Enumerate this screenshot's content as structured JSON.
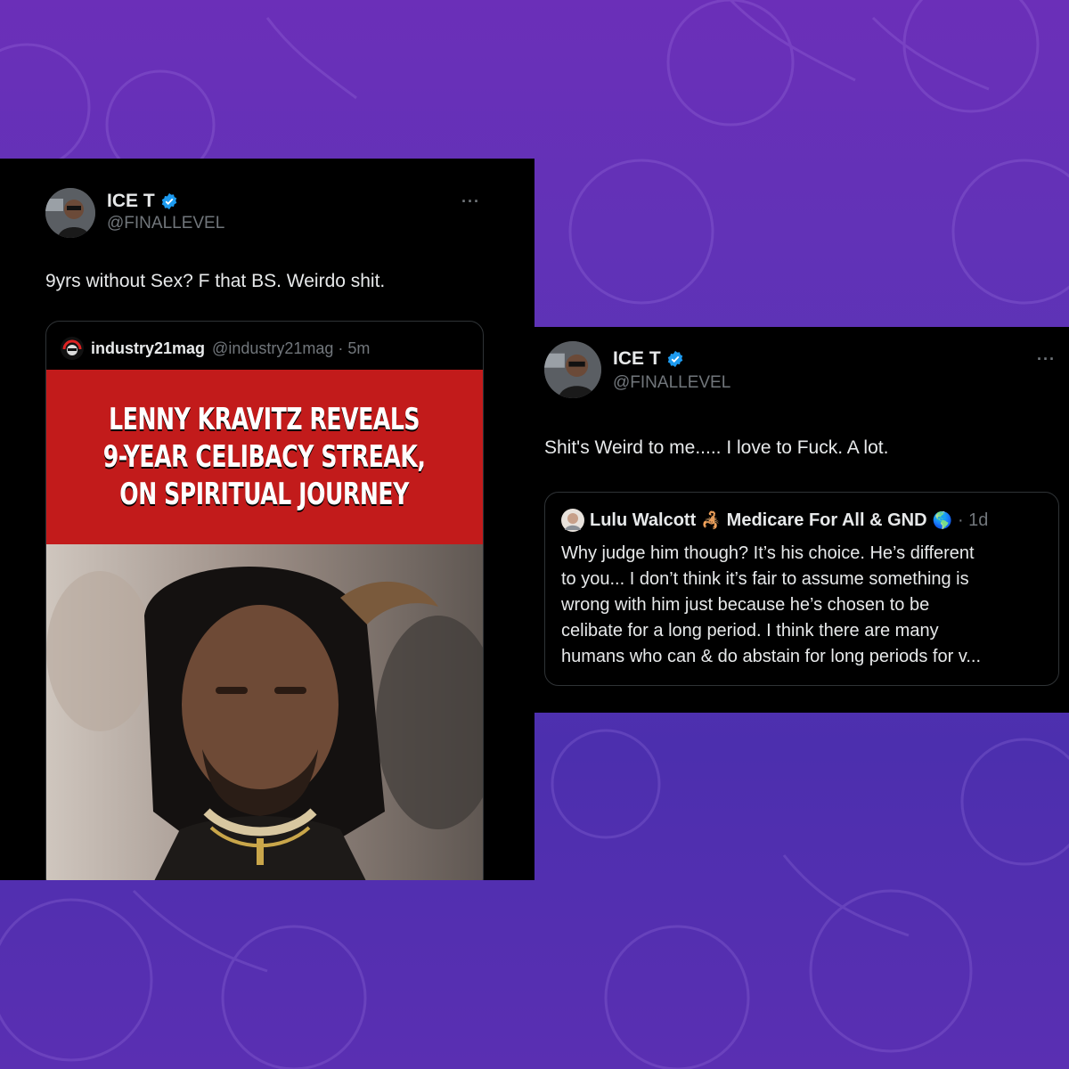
{
  "colors": {
    "background_top": "#6b2fb8",
    "background_bottom": "#4c2fae",
    "card": "#000000",
    "verified": "#1d9bf0",
    "headline_red": "#c21b1b"
  },
  "left_tweet": {
    "name": "ICE T",
    "handle": "@FINALLEVEL",
    "more": "···",
    "text": "9yrs without Sex?  F that BS.  Weirdo shit.",
    "quote": {
      "name": "industry21mag",
      "meta": "@industry21mag · 5m",
      "headline_lines": [
        "LENNY KRAVITZ REVEALS",
        "9-YEAR CELIBACY STREAK,",
        "ON SPIRITUAL JOURNEY"
      ]
    }
  },
  "right_tweet": {
    "name": "ICE T",
    "handle": "@FINALLEVEL",
    "more": "···",
    "text": "Shit's Weird to me..... I love to Fuck. A lot.",
    "quote": {
      "name_part1": "Lulu Walcott",
      "name_emoji1": "🦂",
      "name_part2": "Medicare For All & GND",
      "name_emoji2": "🌎",
      "meta": "· 1d",
      "body_lines": [
        "Why judge him though? It’s his choice. He’s different",
        "to you... I don’t think it’s fair to assume something is",
        "wrong with him just because he’s chosen to be",
        "celibate for a long period. I think there are many",
        "humans who can & do abstain for long periods for v..."
      ]
    }
  }
}
